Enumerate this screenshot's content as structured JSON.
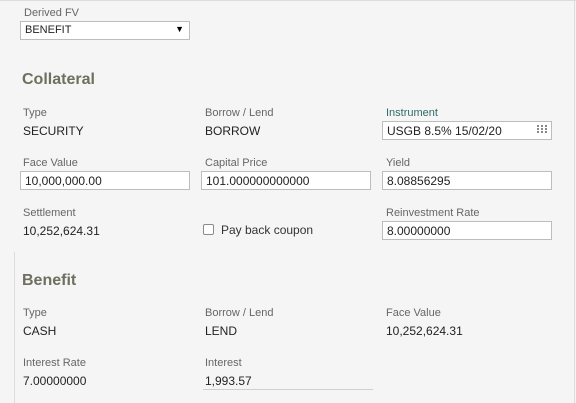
{
  "derived_fv": {
    "label": "Derived FV",
    "value": "BENEFIT"
  },
  "collateral": {
    "title": "Collateral",
    "type": {
      "label": "Type",
      "value": "SECURITY"
    },
    "borrow_lend": {
      "label": "Borrow / Lend",
      "value": "BORROW"
    },
    "instrument": {
      "label": "Instrument",
      "value": "USGB 8.5% 15/02/20"
    },
    "face_value": {
      "label": "Face Value",
      "value": "10,000,000.00"
    },
    "capital_price": {
      "label": "Capital Price",
      "value": "101.000000000000"
    },
    "yield": {
      "label": "Yield",
      "value": "8.08856295"
    },
    "settlement": {
      "label": "Settlement",
      "value": "10,252,624.31"
    },
    "pay_back_coupon": {
      "label": "Pay back coupon",
      "checked": false
    },
    "reinvestment_rate": {
      "label": "Reinvestment Rate",
      "value": "8.00000000"
    }
  },
  "benefit": {
    "title": "Benefit",
    "type": {
      "label": "Type",
      "value": "CASH"
    },
    "borrow_lend": {
      "label": "Borrow / Lend",
      "value": "LEND"
    },
    "face_value": {
      "label": "Face Value",
      "value": "10,252,624.31"
    },
    "interest_rate": {
      "label": "Interest Rate",
      "value": "7.00000000"
    },
    "interest": {
      "label": "Interest",
      "value": "1,993.57"
    }
  },
  "icons": {
    "instrument_lookup": "grid-icon",
    "dropdown": "triangle-down-icon"
  }
}
